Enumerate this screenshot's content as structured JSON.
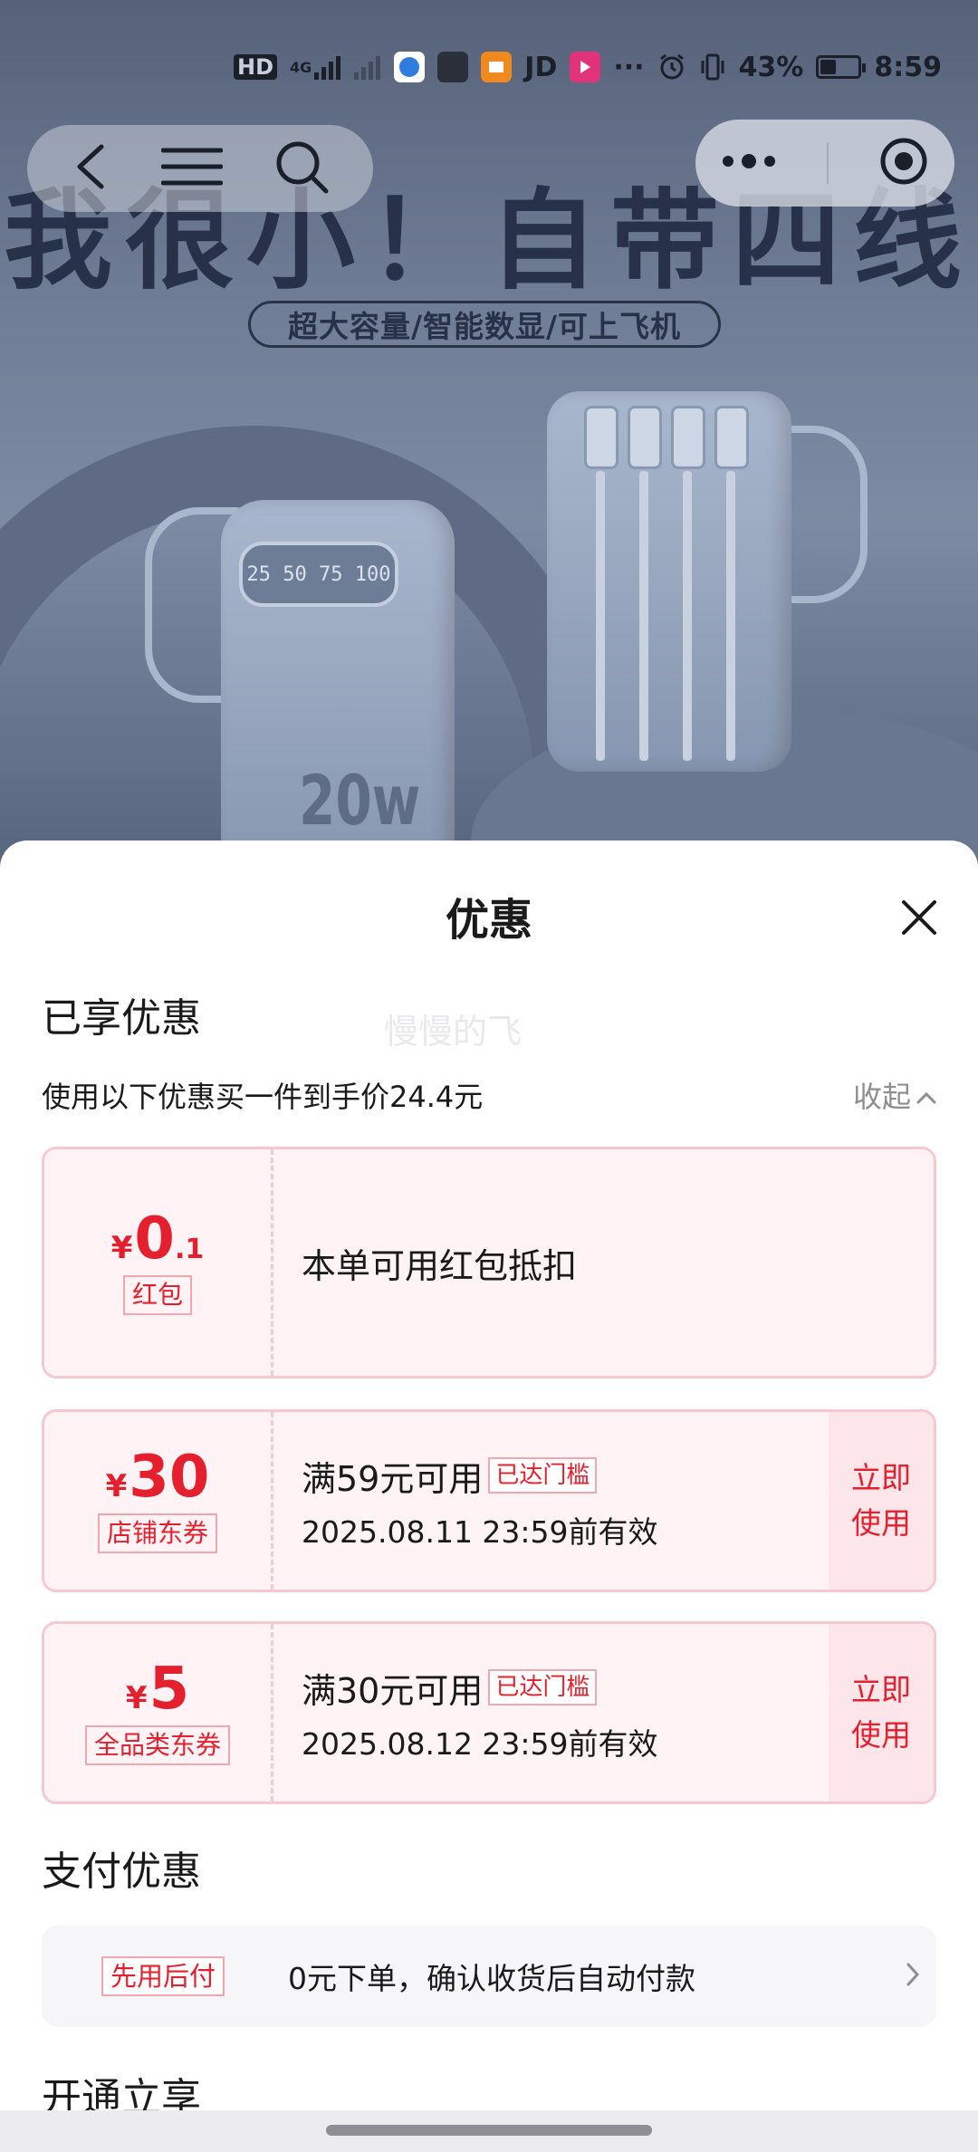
{
  "status_bar": {
    "network": "HD",
    "signal": "4G",
    "app_label": "JD",
    "more": "···",
    "battery_percent": "43%",
    "battery_level": 0.43,
    "time": "8:59"
  },
  "hero": {
    "headline": "我很小！自带四线",
    "subheadline": "超大容量/智能数显/可上飞机",
    "screen_readout": "25 50 75 100",
    "wattage": "20w"
  },
  "sheet": {
    "title": "优惠",
    "enjoyed_title": "已享优惠",
    "watermark": "慢慢的飞",
    "summary": "使用以下优惠买一件到手价24.4元",
    "collapse_label": "收起",
    "coupons": [
      {
        "currency": "¥",
        "amount": "0",
        "decimal": ".1",
        "type": "红包",
        "desc": "本单可用红包抵扣"
      },
      {
        "currency": "¥",
        "amount": "30",
        "type": "店铺东券",
        "condition": "满59元可用",
        "badge": "已达门槛",
        "validity": "2025.08.11 23:59前有效",
        "action_l1": "立即",
        "action_l2": "使用"
      },
      {
        "currency": "¥",
        "amount": "5",
        "type": "全品类东券",
        "condition": "满30元可用",
        "badge": "已达门槛",
        "validity": "2025.08.12 23:59前有效",
        "action_l1": "立即",
        "action_l2": "使用"
      }
    ],
    "payment_title": "支付优惠",
    "payment": {
      "tag": "先用后付",
      "text": "0元下单，确认收货后自动付款"
    },
    "open_title": "开通立享"
  }
}
